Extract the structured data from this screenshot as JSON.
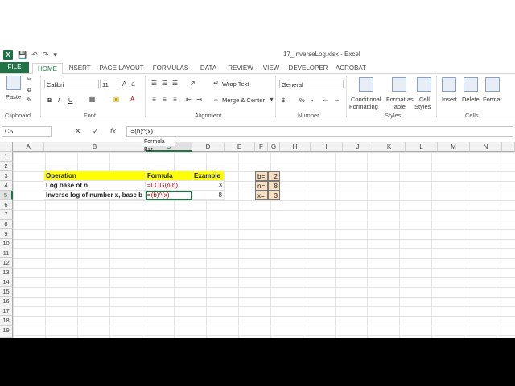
{
  "window": {
    "title": "17_InverseLog.xlsx - Excel",
    "app_logo": "X"
  },
  "qat": {
    "icons": [
      "save-icon",
      "undo-icon",
      "redo-icon",
      "customize-icon"
    ]
  },
  "tabs": [
    {
      "label": "FILE"
    },
    {
      "label": "HOME"
    },
    {
      "label": "INSERT"
    },
    {
      "label": "PAGE LAYOUT"
    },
    {
      "label": "FORMULAS"
    },
    {
      "label": "DATA"
    },
    {
      "label": "REVIEW"
    },
    {
      "label": "VIEW"
    },
    {
      "label": "DEVELOPER"
    },
    {
      "label": "ACROBAT"
    }
  ],
  "ribbon": {
    "clipboard": {
      "paste": "Paste",
      "label": "Clipboard"
    },
    "font": {
      "name": "Calibri",
      "size": "11",
      "bold": "B",
      "italic": "I",
      "underline": "U",
      "label": "Font"
    },
    "alignment": {
      "wrap": "Wrap Text",
      "merge": "Merge & Center",
      "label": "Alignment"
    },
    "number": {
      "format": "General",
      "currency": "$",
      "percent": "%",
      "comma": ",",
      "label": "Number"
    },
    "styles": {
      "conditional_1": "Conditional",
      "conditional_2": "Formatting",
      "format_table_1": "Format as",
      "format_table_2": "Table",
      "cell_styles_1": "Cell",
      "cell_styles_2": "Styles",
      "label": "Styles"
    },
    "cells": {
      "insert": "Insert",
      "delete": "Delete",
      "format": "Format",
      "label": "Cells"
    }
  },
  "formula_bar": {
    "name_box": "C5",
    "cancel": "✕",
    "enter": "✓",
    "fx": "fx",
    "formula": "'=(b)^(x)",
    "tooltip": "Formula Bar"
  },
  "grid": {
    "columns": [
      "A",
      "B",
      "C",
      "D",
      "E",
      "F",
      "G",
      "H",
      "I",
      "J",
      "K",
      "L",
      "M",
      "N"
    ],
    "rows": [
      "1",
      "2",
      "3",
      "4",
      "5",
      "6",
      "7",
      "8",
      "9",
      "10",
      "11",
      "12",
      "13",
      "14",
      "15",
      "16",
      "17",
      "18",
      "19"
    ],
    "selected_col": "C",
    "selected_row": "5",
    "cells": {
      "B3": "Operation",
      "C3": "Formula",
      "D3": "Example",
      "B4": "Log base of n",
      "C4": "=LOG(n,b)",
      "D4": "3",
      "B5": "Inverse log of number x, base b",
      "C5": "=(b)^(x)",
      "D5": "8",
      "F3": "b=",
      "G3": "2",
      "F4": "n=",
      "G4": "8",
      "F5": "x=",
      "G5": "3"
    }
  }
}
